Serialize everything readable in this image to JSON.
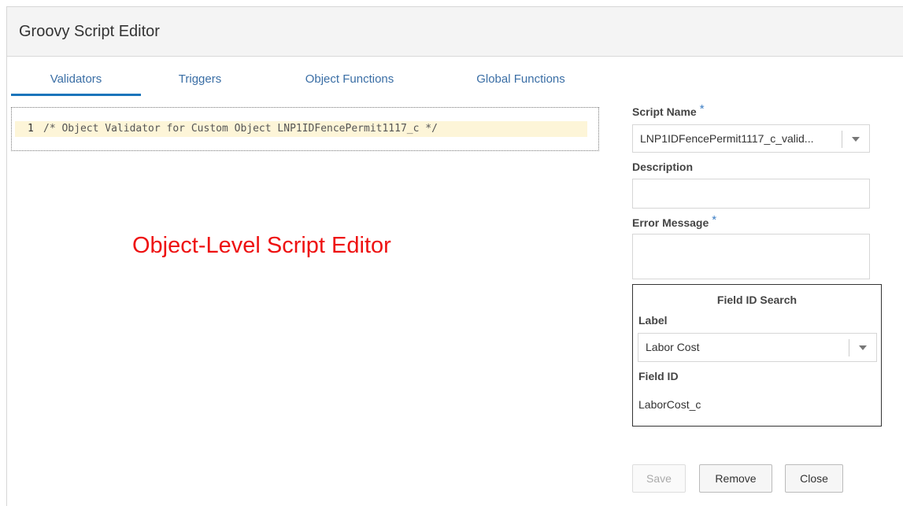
{
  "window": {
    "title": "Groovy Script Editor"
  },
  "tabs": [
    {
      "label": "Validators",
      "active": true
    },
    {
      "label": "Triggers",
      "active": false
    },
    {
      "label": "Object Functions",
      "active": false
    },
    {
      "label": "Global Functions",
      "active": false
    }
  ],
  "editor": {
    "lines": [
      {
        "number": "1",
        "text": "/* Object Validator for Custom Object LNP1IDFencePermit1117_c */"
      }
    ]
  },
  "annotation": {
    "text": "Object-Level Script Editor",
    "color": "#ee1111"
  },
  "form": {
    "script_name": {
      "label": "Script Name",
      "required": "*",
      "value": "LNP1IDFencePermit1117_c_valid..."
    },
    "description": {
      "label": "Description",
      "value": ""
    },
    "error_message": {
      "label": "Error Message",
      "required": "*",
      "value": ""
    }
  },
  "field_id_search": {
    "title": "Field ID Search",
    "label_caption": "Label",
    "label_value": "Labor Cost",
    "field_id_caption": "Field ID",
    "field_id_value": "LaborCost_c"
  },
  "buttons": {
    "save": "Save",
    "remove": "Remove",
    "close": "Close"
  },
  "colors": {
    "tab_text": "#3a6ea5",
    "tab_active_bar": "#1b75bb",
    "required_star": "#3b7dc4",
    "highlight_line": "#fdf5d8"
  }
}
